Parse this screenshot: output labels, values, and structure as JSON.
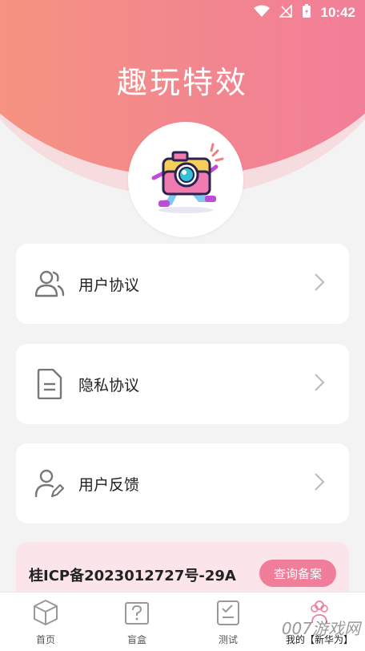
{
  "status": {
    "time": "10:42"
  },
  "app": {
    "title": "趣玩特效"
  },
  "menu": [
    {
      "label": "用户协议",
      "icon": "users-icon"
    },
    {
      "label": "隐私协议",
      "icon": "document-icon"
    },
    {
      "label": "用户反馈",
      "icon": "user-edit-icon"
    }
  ],
  "icp": {
    "text": "桂ICP备2023012727号-29A",
    "button": "查询备案"
  },
  "tabs": [
    {
      "label": "首页",
      "icon": "cube-icon"
    },
    {
      "label": "盲盒",
      "icon": "question-box-icon"
    },
    {
      "label": "测试",
      "icon": "checklist-icon"
    },
    {
      "label": "我的【新华为】",
      "icon": "user-flower-icon"
    }
  ],
  "watermark": "007游戏网",
  "colors": {
    "accent": "#f07d9a",
    "header_start": "#f7977c",
    "header_end": "#f17b9d"
  }
}
